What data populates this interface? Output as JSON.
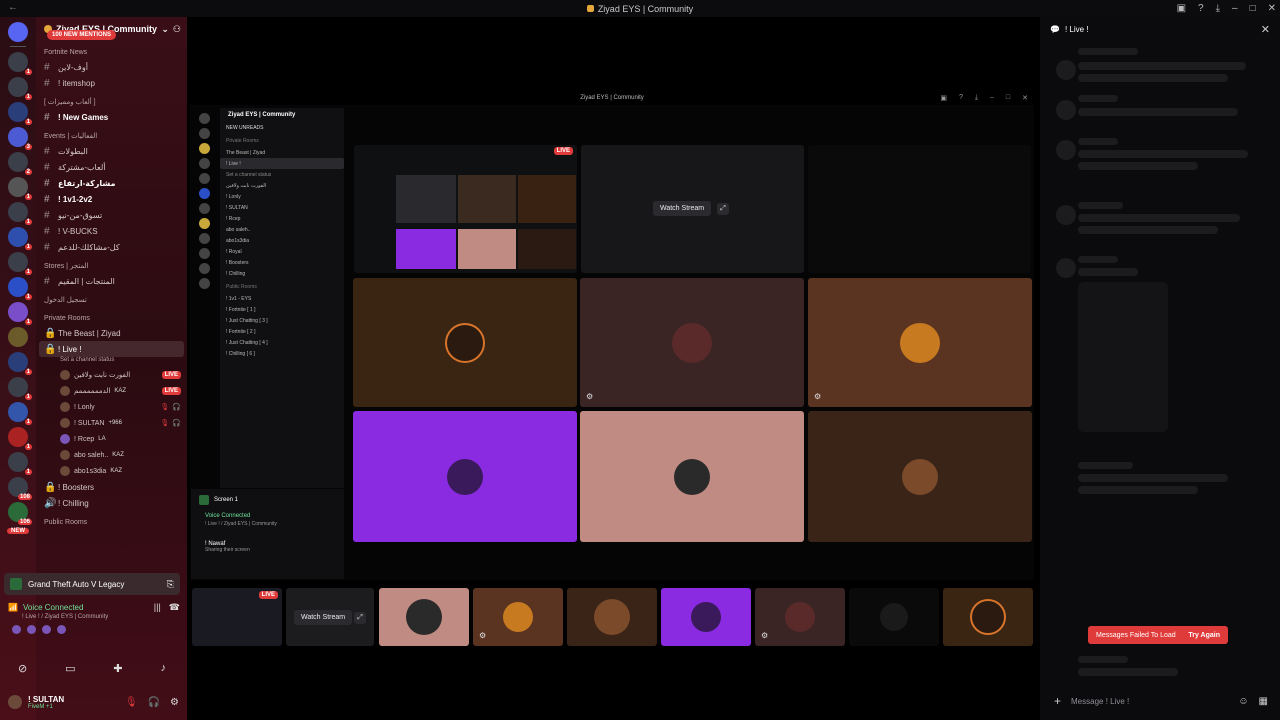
{
  "window": {
    "title": "Ziyad EYS | Community"
  },
  "server": {
    "name": "Ziyad EYS | Community",
    "mentions_badge": "100 NEW MENTIONS"
  },
  "rail": {
    "badges": [
      "1",
      "1",
      "1",
      "3",
      "2",
      "1",
      "1",
      "1",
      "1",
      "1",
      "1",
      "1",
      "1",
      "1",
      "1",
      "1",
      "1",
      "1",
      "1",
      "108",
      "106"
    ],
    "new_label": "NEW"
  },
  "categories": {
    "fortnite": "Fortnite News",
    "games": "[ ألعاب ومميزات ]",
    "events": "Events | الفعاليات",
    "stores": "Stores | المتجر",
    "login": "تسجيل الدخول",
    "private": "Private Rooms",
    "public": "Public Rooms"
  },
  "channels": [
    {
      "name": "أوف-لاين",
      "icon": "#"
    },
    {
      "name": "! itemshop",
      "icon": "#"
    },
    {
      "name": "! New  Games",
      "icon": "#"
    },
    {
      "name": "البطولات",
      "icon": "#"
    },
    {
      "name": "ألعاب-مشتركة",
      "icon": "#"
    },
    {
      "name": "مشاركة-ارتفاع",
      "icon": "#"
    },
    {
      "name": "! 1v1-2v2",
      "icon": "#"
    },
    {
      "name": "تسوق-من-نيو",
      "icon": "#"
    },
    {
      "name": "! V-BUCKS",
      "icon": "#"
    },
    {
      "name": "كل-مشاكلك-للدعم",
      "icon": "#"
    },
    {
      "name": "المنتجات | المقيم",
      "icon": "#"
    }
  ],
  "private_rooms": {
    "the_beast": "The Beast | Ziyad",
    "live_channel": "! Live !",
    "channel_status": "Set a channel status",
    "members": [
      {
        "name": "الفورت نايت ولافين",
        "tag": "",
        "live": "LIVE"
      },
      {
        "name": "الدممممممم",
        "tag": "KAZ",
        "live": "LIVE"
      },
      {
        "name": "! Lonly",
        "tag": "",
        "live": ""
      },
      {
        "name": "! SULTAN",
        "tag": "+966",
        "live": ""
      },
      {
        "name": "! Rcep",
        "tag": "LA",
        "live": ""
      },
      {
        "name": "abo saleh..",
        "tag": "KAZ",
        "live": ""
      },
      {
        "name": "abo1s3dia",
        "tag": "KAZ",
        "live": ""
      }
    ],
    "boosters": "! Boosters",
    "chilling": "! Chilling"
  },
  "activity": {
    "game": "Grand Theft Auto V Legacy"
  },
  "voice": {
    "status": "Voice Connected",
    "location": "! Live ! / Ziyad EYS | Community"
  },
  "user": {
    "name": "! SULTAN",
    "status": "FiveM +1"
  },
  "stage": {
    "watch_stream": "Watch Stream",
    "live_badge": "LIVE",
    "nested_title": "Ziyad EYS | Community",
    "nested_server": "Ziyad EYS | Community",
    "nested_new_unreads": "NEW UNREADS",
    "nested_rows": [
      "Private Rooms",
      "The Beast | Ziyad",
      "! Live !",
      "Set a channel status",
      "الفورت نايت ولافين",
      "! Lonly",
      "! SULTAN",
      "! Rcep",
      "abo saleh..",
      "abo1s3dia",
      "! Royal",
      "! Boosters",
      "! Chilling",
      "Public Rooms",
      "! 1v1 - EYS",
      "! Fortnite [ 1 ]",
      "! Just Chatting [ 3 ]",
      "! Fortnite [ 2 ]",
      "! Just Chatting [ 4 ]",
      "! Chilling [ 6 ]",
      "! Chilling [ 6 ]"
    ],
    "nested_screen": "Screen 1",
    "nested_voice": "Voice Connected",
    "nested_voice_loc": "! Live ! / Ziyad EYS | Community",
    "nested_user": "! Nawaf",
    "nested_user_sub": "Sharing their screen"
  },
  "chat": {
    "channel": "! Live !",
    "error": "Messages Failed To Load",
    "retry": "Try Again",
    "placeholder": "Message  ! Live !"
  },
  "colors": {
    "accent": "#e03b3b",
    "purple": "#8a2be2",
    "pink": "#c08b82",
    "brown": "#4a2a1a"
  }
}
